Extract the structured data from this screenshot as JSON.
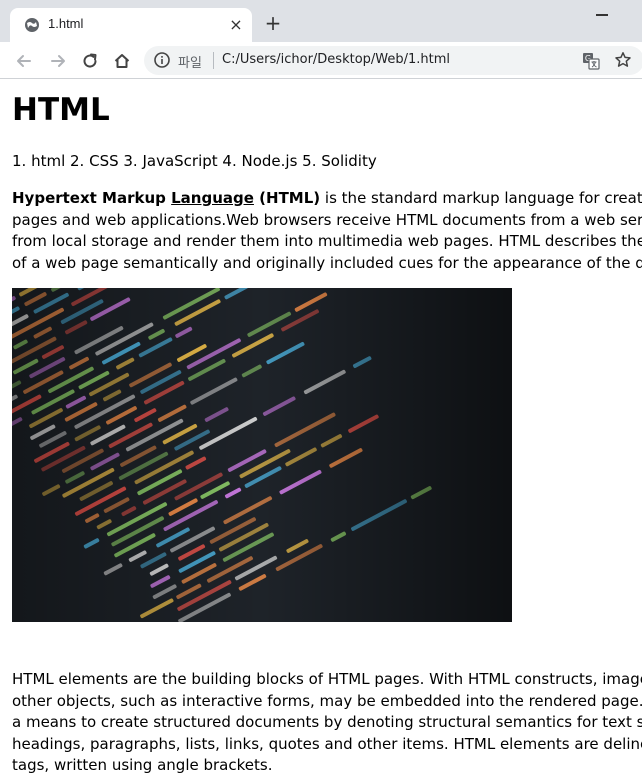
{
  "browser": {
    "tab": {
      "title": "1.html",
      "close_glyph": "×"
    },
    "new_tab_glyph": "+",
    "omnibox": {
      "scheme_label": "파일",
      "url": "C:/Users/ichor/Desktop/Web/1.html"
    },
    "icons": {
      "favicon": "globe-icon",
      "back": "arrow-left-icon",
      "forward": "arrow-right-icon",
      "reload": "reload-icon",
      "home": "home-icon",
      "info": "info-icon",
      "translate": "translate-icon",
      "bookmark": "star-icon"
    }
  },
  "page": {
    "heading": "HTML",
    "list_line": "1. html 2. CSS 3. JavaScript 4. Node.js 5. Solidity",
    "intro": {
      "bold_lead": "Hypertext Markup ",
      "bold_underlined": "Language",
      "bold_tail": " (HTML)",
      "line1_rest": " is the standard markup language for creating web",
      "line2": "pages and web applications.Web browsers receive HTML documents from a web server or",
      "line3": "from local storage and render them into multimedia web pages. HTML describes the structure",
      "line4": "of a web page semantically and originally included cues for the appearance of the document."
    },
    "image": {
      "subject": "code-editor-screenshot"
    },
    "outro": {
      "line1": "HTML elements are the building blocks of HTML pages. With HTML constructs, images and",
      "line2": "other objects, such as interactive forms, may be embedded into the rendered page. It provides",
      "line3": "a means to create structured documents by denoting structural semantics for text such as",
      "line4": "headings, paragraphs, lists, links, quotes and other items. HTML elements are delineated by",
      "line5": "tags, written using angle brackets."
    }
  }
}
